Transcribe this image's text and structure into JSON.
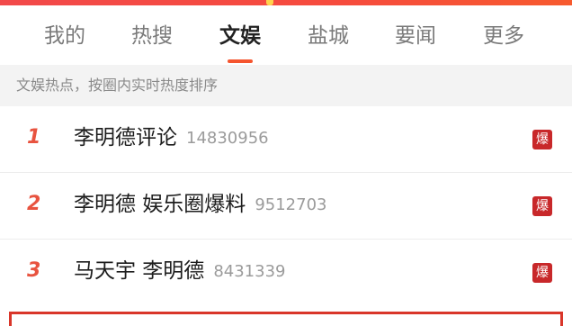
{
  "tabs": [
    {
      "label": "我的",
      "active": false
    },
    {
      "label": "热搜",
      "active": false
    },
    {
      "label": "文娱",
      "active": true
    },
    {
      "label": "盐城",
      "active": false
    },
    {
      "label": "要闻",
      "active": false
    },
    {
      "label": "更多",
      "active": false
    }
  ],
  "subheader": {
    "text": "文娱热点，按圈内实时热度排序"
  },
  "list": [
    {
      "rank": "1",
      "title": "李明德评论",
      "count": "14830956",
      "badge": "爆"
    },
    {
      "rank": "2",
      "title": "李明德 娱乐圈爆料",
      "count": "9512703",
      "badge": "爆"
    },
    {
      "rank": "3",
      "title": "马天宇 李明德",
      "count": "8431339",
      "badge": "爆"
    }
  ],
  "colors": {
    "accent": "#f5552f",
    "rank": "#e8533f",
    "badge": "#c8282a"
  }
}
